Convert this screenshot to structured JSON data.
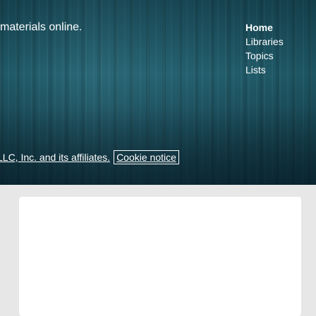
{
  "footer": {
    "tagline": "materials online.",
    "nav": {
      "items": [
        {
          "label": "Home"
        },
        {
          "label": "Libraries"
        },
        {
          "label": "Topics"
        },
        {
          "label": "Lists"
        }
      ]
    },
    "copyright_text": "LLC, Inc. and its affiliates.",
    "cookie_notice_label": "Cookie notice"
  },
  "colors": {
    "footer_bg": "#24606f",
    "panel_bg": "#e7e7e7",
    "card_bg": "#ffffff",
    "text": "#ffffff"
  }
}
